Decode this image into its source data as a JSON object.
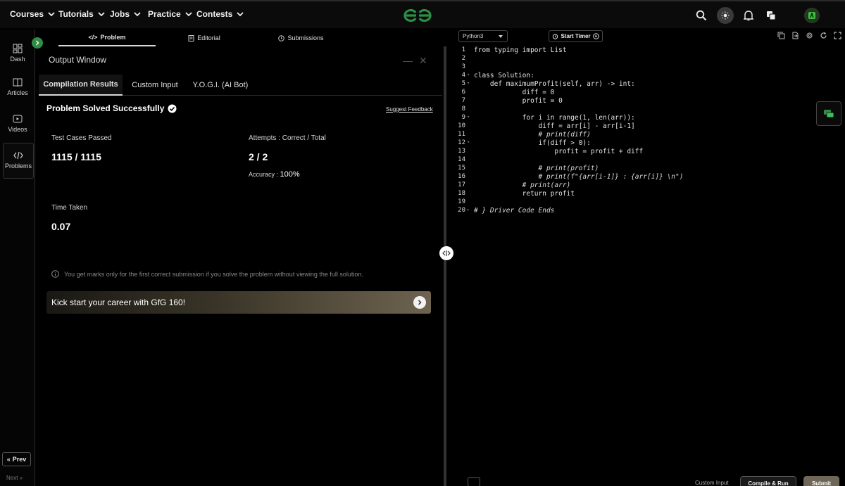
{
  "nav": {
    "items": [
      "Courses",
      "Tutorials",
      "Jobs",
      "Practice",
      "Contests"
    ]
  },
  "sidebar": {
    "items": [
      {
        "label": "Dash",
        "icon": "dashboard-icon"
      },
      {
        "label": "Articles",
        "icon": "book-icon"
      },
      {
        "label": "Videos",
        "icon": "video-icon"
      },
      {
        "label": "Problems",
        "icon": "code-icon"
      }
    ],
    "prev_label": "Prev",
    "next_label": "Next"
  },
  "problem_tabs": [
    "Problem",
    "Editorial",
    "Submissions"
  ],
  "output": {
    "title": "Output Window",
    "tabs": [
      "Compilation Results",
      "Custom Input",
      "Y.O.G.I. (AI Bot)"
    ],
    "success_text": "Problem Solved Successfully",
    "feedback_link": "Suggest Feedback",
    "test_cases_label": "Test Cases Passed",
    "test_cases_value": "1115 / 1115",
    "attempts_label": "Attempts : Correct / Total",
    "attempts_value": "2 / 2",
    "accuracy_label": "Accuracy :",
    "accuracy_value": "100%",
    "time_label": "Time Taken",
    "time_value": "0.07",
    "note": "You get marks only for the first correct submission if you solve the problem without viewing the full solution.",
    "banner_text": "Kick start your career with GfG 160!"
  },
  "editor": {
    "language": "Python3",
    "timer_label": "Start Timer",
    "lines": [
      "from typing import List",
      "",
      "",
      "class Solution:",
      "    def maximumProfit(self, arr) -> int:",
      "            diff = 0",
      "            profit = 0",
      "",
      "            for i in range(1, len(arr)):",
      "                diff = arr[i] - arr[i-1]",
      "                # print(diff)",
      "                if(diff > 0):",
      "                    profit = profit + diff",
      "",
      "                # print(profit)",
      "                # print(f\"{arr[i-1]} : {arr[i]} \\n\")",
      "            # print(arr)",
      "            return profit",
      "",
      "# } Driver Code Ends"
    ],
    "custom_input_label": "Custom Input",
    "compile_label": "Compile & Run",
    "submit_label": "Submit"
  },
  "colors": {
    "brand_green": "#2f8d46",
    "background": "#000000",
    "submit": "#6f6858"
  }
}
